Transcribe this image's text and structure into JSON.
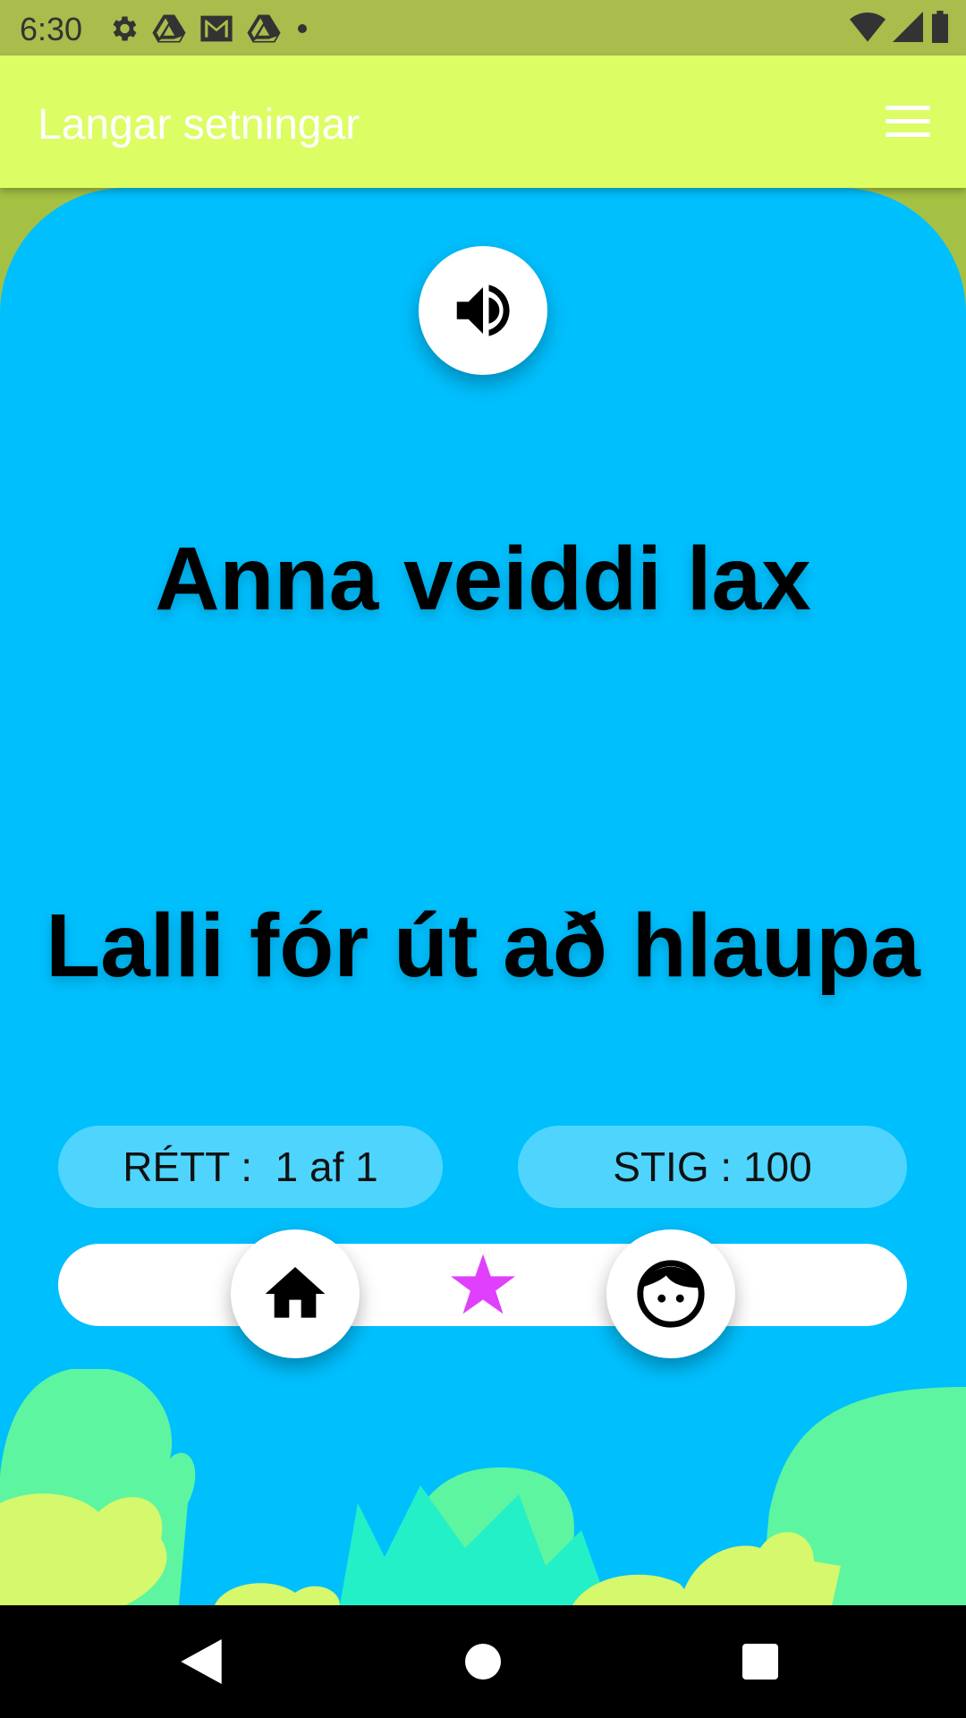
{
  "status_bar": {
    "time": "6:30",
    "left_icons": [
      "gear-icon",
      "drive-icon",
      "gmail-icon",
      "drive-icon",
      "dot-icon"
    ],
    "right_icons": [
      "wifi-icon",
      "signal-icon",
      "battery-icon"
    ]
  },
  "app_bar": {
    "title": "Langar setningar",
    "menu_icon": "hamburger-menu-icon"
  },
  "exercise": {
    "sound_icon": "speaker-icon",
    "sentences": [
      "Anna veiddi lax",
      "Lalli fór út að hlaupa"
    ]
  },
  "score": {
    "correct_label": "RÉTT :  1 af 1",
    "points_label": "STIG : 100"
  },
  "progress": {
    "stars_earned": 1,
    "star_icon": "star-icon",
    "star_color": "#e040fb"
  },
  "bottom_buttons": {
    "home_icon": "home-icon",
    "profile_icon": "face-icon"
  },
  "nav_bar": {
    "back_icon": "back-triangle-icon",
    "home_icon": "home-circle-icon",
    "recent_icon": "recent-square-icon"
  },
  "colors": {
    "app_bar": "#dcfd64",
    "status_bar": "#a9bc4c",
    "card": "#00bffd",
    "pill": "#4fd5fd"
  }
}
